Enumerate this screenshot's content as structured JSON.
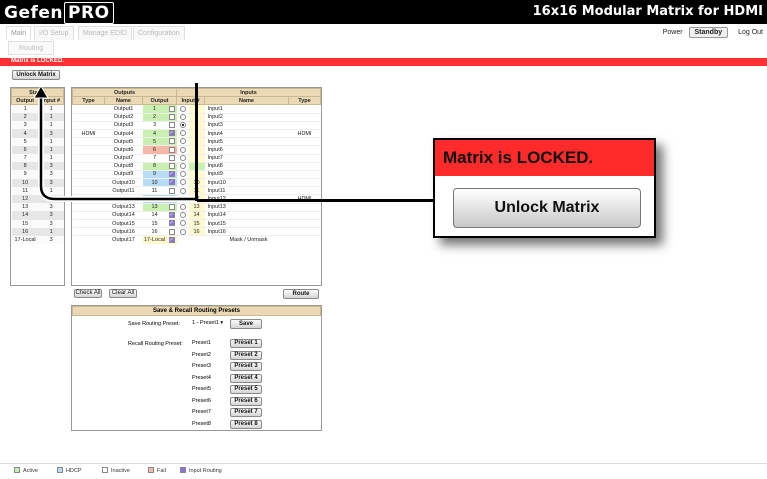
{
  "header": {
    "brand": "Gefen",
    "brand_pro": "PRO",
    "device_title": "16x16 Modular Matrix for HDMI"
  },
  "nav": {
    "tabs": [
      "Main",
      "I/O Setup",
      "Manage EDID",
      "Configuration"
    ],
    "subtab": "Routing",
    "power_label": "Power",
    "standby_label": "Standby",
    "logout_label": "Log Out"
  },
  "lock": {
    "message": "Matrix is LOCKED.",
    "unlock_label": "Unlock Matrix"
  },
  "status_table": {
    "title": "Status",
    "headers": [
      "Output",
      "Input #"
    ],
    "rows": [
      [
        "1",
        "1"
      ],
      [
        "2",
        "1"
      ],
      [
        "3",
        "1"
      ],
      [
        "4",
        "3"
      ],
      [
        "5",
        "1"
      ],
      [
        "6",
        "1"
      ],
      [
        "7",
        "1"
      ],
      [
        "8",
        "3"
      ],
      [
        "9",
        "3"
      ],
      [
        "10",
        "3"
      ],
      [
        "11",
        "1"
      ],
      [
        "12",
        "3"
      ],
      [
        "13",
        "3"
      ],
      [
        "14",
        "3"
      ],
      [
        "15",
        "3"
      ],
      [
        "16",
        "1"
      ],
      [
        "17-Local",
        "3"
      ]
    ]
  },
  "outputs": {
    "title": "Outputs",
    "headers": [
      "Type",
      "Name",
      "Output"
    ],
    "group_types": [
      "HDMI",
      "HDMI"
    ],
    "rows": [
      [
        "Output1",
        "1"
      ],
      [
        "Output2",
        "2"
      ],
      [
        "Output3",
        "3"
      ],
      [
        "Output4",
        "4"
      ],
      [
        "Output5",
        "5"
      ],
      [
        "Output6",
        "6"
      ],
      [
        "Output7",
        "7"
      ],
      [
        "Output8",
        "8"
      ],
      [
        "Output9",
        "9"
      ],
      [
        "Output10",
        "10"
      ],
      [
        "Output11",
        "11"
      ],
      [
        "Output12",
        "12"
      ],
      [
        "Output13",
        "13"
      ],
      [
        "Output14",
        "14"
      ],
      [
        "Output15",
        "15"
      ],
      [
        "Output16",
        "16"
      ],
      [
        "Output17",
        "17-Local"
      ]
    ]
  },
  "inputs": {
    "title": "Inputs",
    "headers": [
      "Input #",
      "Name",
      "Type"
    ],
    "group_types": [
      "HDMI",
      "HDMI"
    ],
    "rows": [
      [
        "1",
        "Input1"
      ],
      [
        "2",
        "Input2"
      ],
      [
        "3",
        "Input3"
      ],
      [
        "4",
        "Input4"
      ],
      [
        "5",
        "Input5"
      ],
      [
        "6",
        "Input6"
      ],
      [
        "7",
        "Input7"
      ],
      [
        "8",
        "Input8"
      ],
      [
        "9",
        "Input9"
      ],
      [
        "10",
        "Input10"
      ],
      [
        "11",
        "Input11"
      ],
      [
        "12",
        "Input12"
      ],
      [
        "13",
        "Input13"
      ],
      [
        "14",
        "Input14"
      ],
      [
        "15",
        "Input15"
      ],
      [
        "16",
        "Input16"
      ]
    ],
    "mask_label": "Mask / Unmask"
  },
  "buttons": {
    "check_all": "Check All",
    "clear_all": "Clear All",
    "route": "Route"
  },
  "presets": {
    "title": "Save & Recall Routing Presets",
    "save_label": "Save Routing Preset:",
    "save_select": "1 - Preset1",
    "save_button": "Save",
    "recall_label": "Recall Routing Preset:",
    "items": [
      [
        "Preset1",
        "Preset 1"
      ],
      [
        "Preset2",
        "Preset 2"
      ],
      [
        "Preset3",
        "Preset 3"
      ],
      [
        "Preset4",
        "Preset 4"
      ],
      [
        "Preset5",
        "Preset 5"
      ],
      [
        "Preset6",
        "Preset 6"
      ],
      [
        "Preset7",
        "Preset 7"
      ],
      [
        "Preset8",
        "Preset 8"
      ]
    ]
  },
  "legend": [
    {
      "label": "Active",
      "color": "#c9f0b0"
    },
    {
      "label": "HDCP",
      "color": "#b8dcf5"
    },
    {
      "label": "Inactive",
      "color": "#ffffff"
    },
    {
      "label": "Fail",
      "color": "#f5b8a8"
    },
    {
      "label": "Input Routing",
      "color": "#8a6fe8"
    }
  ],
  "callout": {
    "message": "Matrix is LOCKED.",
    "button": "Unlock Matrix"
  },
  "selected_input": 3,
  "checked_outputs": [
    4,
    9,
    10,
    12,
    14,
    15,
    17
  ],
  "row_colors": [
    "#c9f0b0",
    "#c9f0b0",
    "#ffffff",
    "#c9f0b0",
    "#c9f0b0",
    "#f5b8a8",
    "#ffffff",
    "#c9f0b0",
    "#b8dcf5",
    "#b8dcf5",
    "#ffffff",
    "#b8dcf5",
    "#c9f0b0",
    "#ffffff",
    "#ffffff",
    "#ffffff",
    "#fffacd"
  ],
  "input_colors": [
    "#fffacd",
    "#fffacd",
    "#fffacd",
    "#fffacd",
    "#fffacd",
    "#fffacd",
    "#fffacd",
    "#c9f0b0",
    "#fffacd",
    "#fffacd",
    "#fffacd",
    "#fffacd",
    "#fffacd",
    "#fffacd",
    "#fffacd",
    "#fffacd"
  ]
}
